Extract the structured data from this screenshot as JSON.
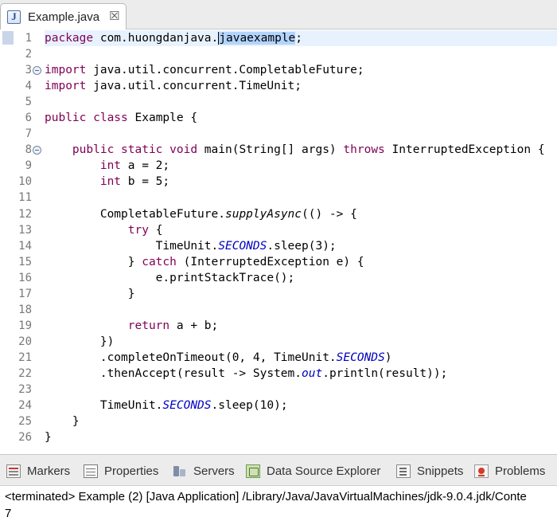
{
  "editor_tab": {
    "icon": "java-file-icon",
    "label": "Example.java",
    "close_glyph": "☒"
  },
  "editor": {
    "line_numbers": [
      "1",
      "2",
      "3",
      "4",
      "5",
      "6",
      "7",
      "8",
      "9",
      "10",
      "11",
      "12",
      "13",
      "14",
      "15",
      "16",
      "17",
      "18",
      "19",
      "20",
      "21",
      "22",
      "23",
      "24",
      "25",
      "26"
    ],
    "lines": [
      [
        {
          "t": "package ",
          "c": "kw"
        },
        {
          "t": "com.huongdanjava."
        },
        {
          "t": "javaexample",
          "c": "sel"
        },
        {
          "t": ";"
        }
      ],
      [],
      [
        {
          "t": "import ",
          "c": "kw"
        },
        {
          "t": "java.util.concurrent.CompletableFuture;"
        }
      ],
      [
        {
          "t": "import ",
          "c": "kw"
        },
        {
          "t": "java.util.concurrent.TimeUnit;"
        }
      ],
      [],
      [
        {
          "t": "public ",
          "c": "kw"
        },
        {
          "t": "class ",
          "c": "kw"
        },
        {
          "t": "Example {"
        }
      ],
      [],
      [
        {
          "t": "    "
        },
        {
          "t": "public ",
          "c": "kw"
        },
        {
          "t": "static ",
          "c": "kw"
        },
        {
          "t": "void ",
          "c": "kw"
        },
        {
          "t": "main(String[] args) "
        },
        {
          "t": "throws ",
          "c": "kw"
        },
        {
          "t": "InterruptedException {"
        }
      ],
      [
        {
          "t": "        "
        },
        {
          "t": "int ",
          "c": "kw"
        },
        {
          "t": "a = 2;"
        }
      ],
      [
        {
          "t": "        "
        },
        {
          "t": "int ",
          "c": "kw"
        },
        {
          "t": "b = 5;"
        }
      ],
      [],
      [
        {
          "t": "        CompletableFuture."
        },
        {
          "t": "supplyAsync",
          "c": "mi"
        },
        {
          "t": "(() -> {"
        }
      ],
      [
        {
          "t": "            "
        },
        {
          "t": "try ",
          "c": "kw"
        },
        {
          "t": "{"
        }
      ],
      [
        {
          "t": "                TimeUnit."
        },
        {
          "t": "SECONDS",
          "c": "fi"
        },
        {
          "t": ".sleep(3);"
        }
      ],
      [
        {
          "t": "            } "
        },
        {
          "t": "catch ",
          "c": "kw"
        },
        {
          "t": "(InterruptedException e) {"
        }
      ],
      [
        {
          "t": "                e.printStackTrace();"
        }
      ],
      [
        {
          "t": "            }"
        }
      ],
      [],
      [
        {
          "t": "            "
        },
        {
          "t": "return ",
          "c": "kw"
        },
        {
          "t": "a + b;"
        }
      ],
      [
        {
          "t": "        })"
        }
      ],
      [
        {
          "t": "        .completeOnTimeout(0, 4, TimeUnit."
        },
        {
          "t": "SECONDS",
          "c": "fi"
        },
        {
          "t": ")"
        }
      ],
      [
        {
          "t": "        .thenAccept(result -> System."
        },
        {
          "t": "out",
          "c": "fi"
        },
        {
          "t": ".println(result));"
        }
      ],
      [],
      [
        {
          "t": "        TimeUnit."
        },
        {
          "t": "SECONDS",
          "c": "fi"
        },
        {
          "t": ".sleep(10);"
        }
      ],
      [
        {
          "t": "    }"
        }
      ],
      [
        {
          "t": "}"
        }
      ]
    ],
    "fold_lines": [
      3,
      8
    ]
  },
  "views": {
    "tabs": [
      {
        "label": "Markers",
        "icon": "markers-icon"
      },
      {
        "label": "Properties",
        "icon": "properties-icon"
      },
      {
        "label": "Servers",
        "icon": "servers-icon"
      },
      {
        "label": "Data Source Explorer",
        "icon": "data-source-explorer-icon"
      },
      {
        "label": "Snippets",
        "icon": "snippets-icon"
      },
      {
        "label": "Problems",
        "icon": "problems-icon"
      }
    ]
  },
  "console": {
    "status": "<terminated> Example (2) [Java Application] /Library/Java/JavaVirtualMachines/jdk-9.0.4.jdk/Conte",
    "output": "7"
  },
  "colors": {
    "keyword": "#7f0055",
    "static_field": "#0000c0",
    "selection": "#b3d4fc",
    "current_line": "#e8f2fe"
  }
}
